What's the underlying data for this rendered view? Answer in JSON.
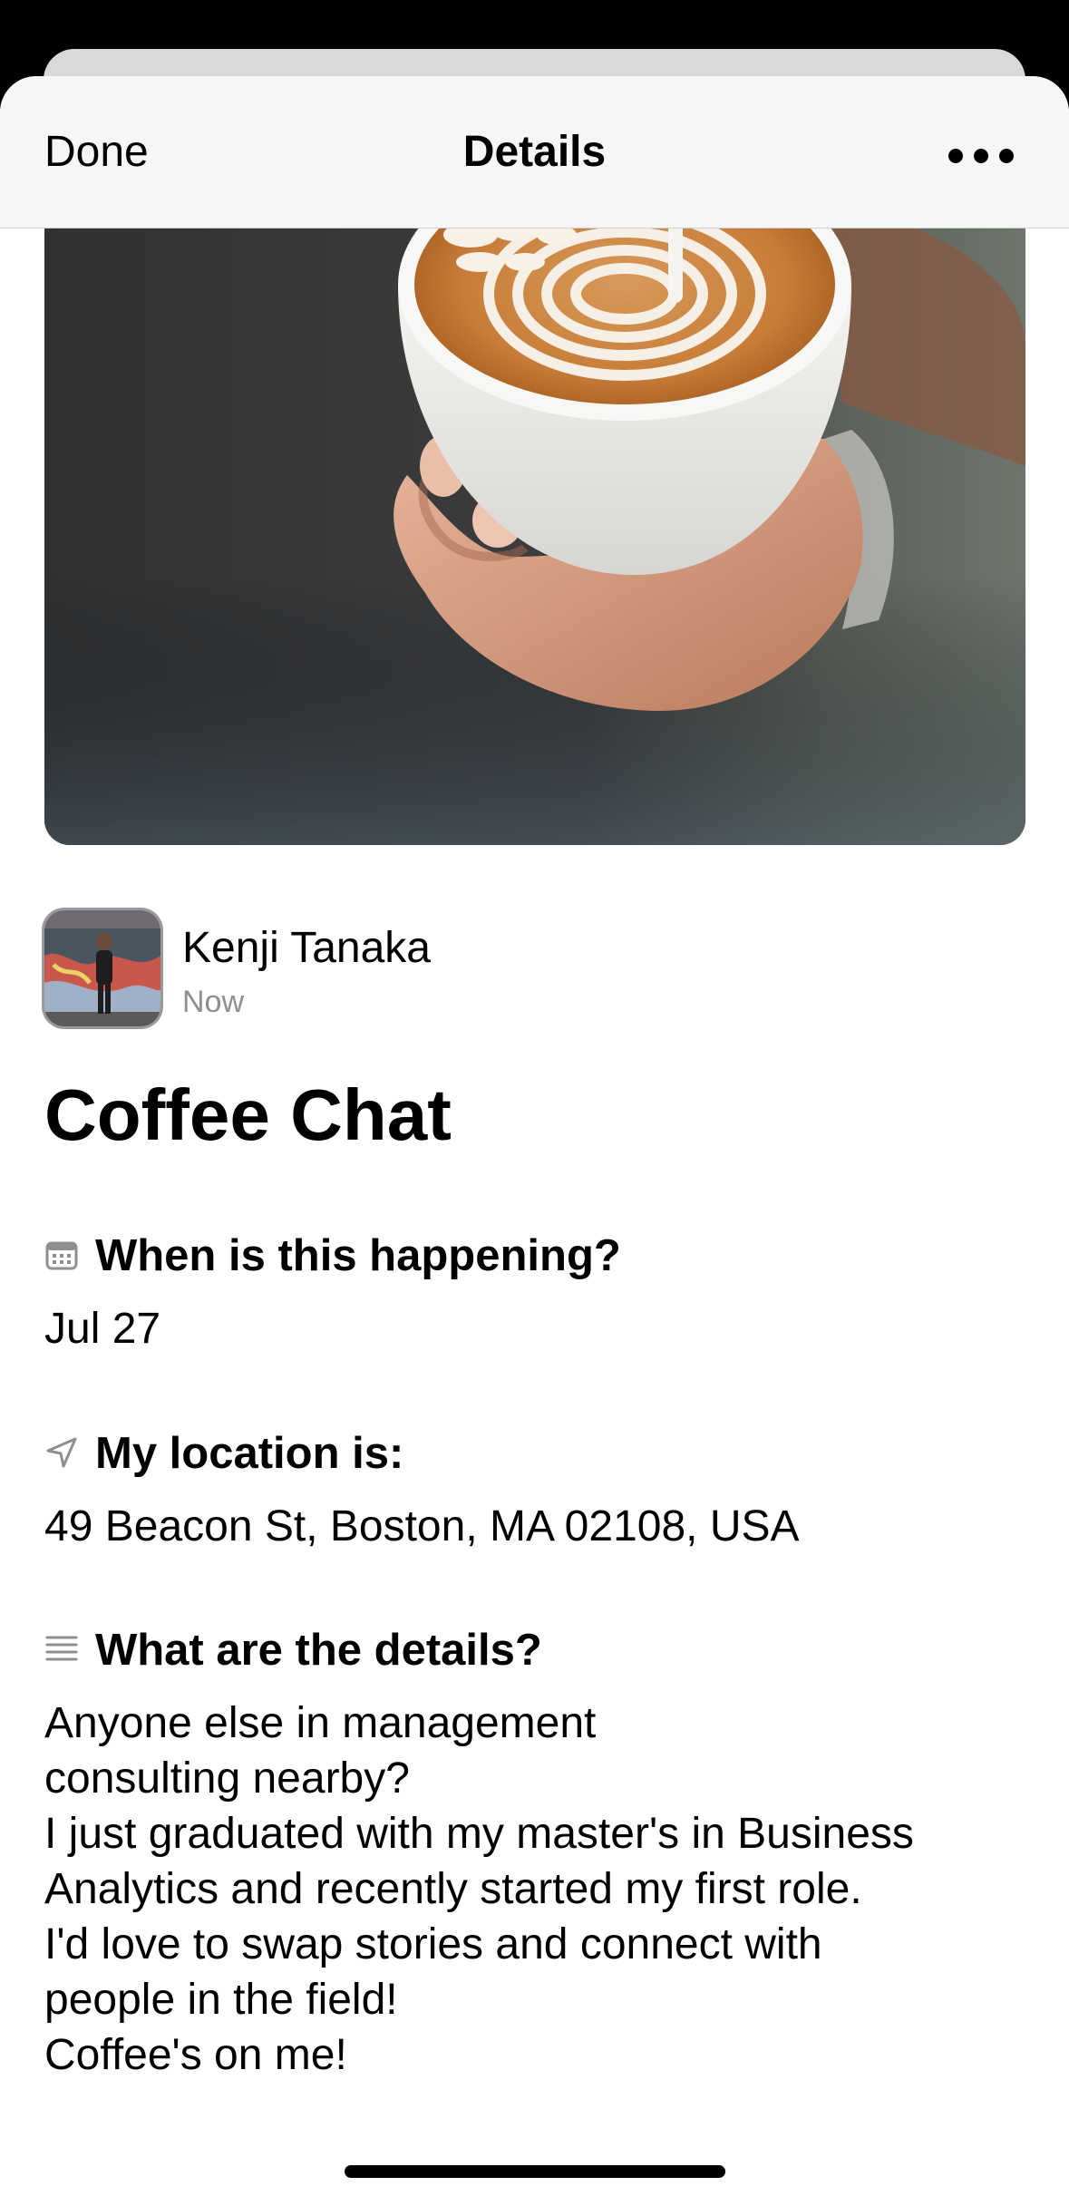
{
  "navbar": {
    "done_label": "Done",
    "title": "Details",
    "more_icon": "ellipsis-icon"
  },
  "hero": {
    "image": "latte-art-coffee-cup-photo"
  },
  "post": {
    "author_name": "Kenji Tanaka",
    "timestamp": "Now",
    "title": "Coffee Chat"
  },
  "fields": [
    {
      "icon": "calendar-icon",
      "label": "When is this happening?",
      "value": "Jul 27"
    },
    {
      "icon": "location-arrow-icon",
      "label": "My location is:",
      "value": "49 Beacon St, Boston, MA 02108, USA"
    },
    {
      "icon": "text-lines-icon",
      "label": "What are the details?",
      "value": "Anyone else in management\nconsulting nearby?\nI just graduated with my master's in Business\nAnalytics and recently started my first role.\nI'd love to swap stories and connect with\npeople in the field!\nCoffee's on me!"
    }
  ]
}
